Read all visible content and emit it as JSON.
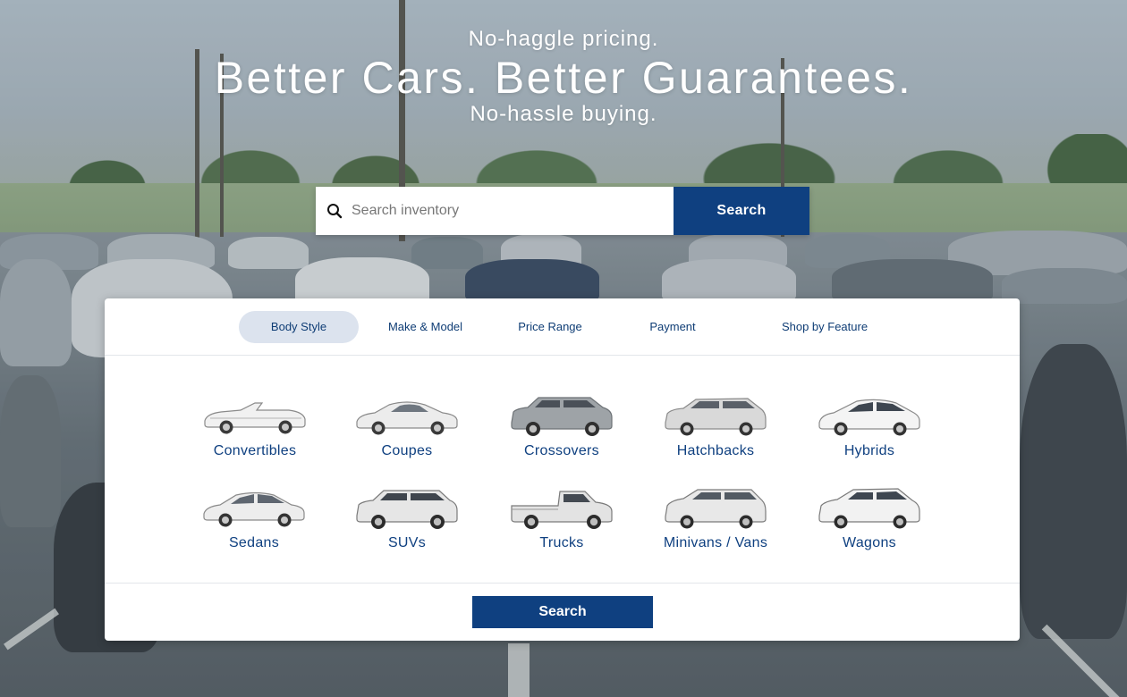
{
  "hero": {
    "line1": "No-haggle pricing.",
    "title": "Better Cars. Better Guarantees.",
    "line2": "No-hassle buying."
  },
  "search": {
    "placeholder": "Search inventory",
    "button_label": "Search"
  },
  "tabs": [
    {
      "label": "Body Style",
      "active": true
    },
    {
      "label": "Make & Model",
      "active": false
    },
    {
      "label": "Price Range",
      "active": false
    },
    {
      "label": "Payment",
      "active": false
    },
    {
      "label": "Shop by Feature",
      "active": false
    }
  ],
  "body_styles": [
    {
      "label": "Convertibles",
      "icon": "convertible-icon"
    },
    {
      "label": "Coupes",
      "icon": "coupe-icon"
    },
    {
      "label": "Crossovers",
      "icon": "crossover-icon"
    },
    {
      "label": "Hatchbacks",
      "icon": "hatchback-icon"
    },
    {
      "label": "Hybrids",
      "icon": "hybrid-icon"
    },
    {
      "label": "Sedans",
      "icon": "sedan-icon"
    },
    {
      "label": "SUVs",
      "icon": "suv-icon"
    },
    {
      "label": "Trucks",
      "icon": "truck-icon"
    },
    {
      "label": "Minivans / Vans",
      "icon": "minivan-icon"
    },
    {
      "label": "Wagons",
      "icon": "wagon-icon"
    }
  ],
  "panel": {
    "search_label": "Search"
  },
  "colors": {
    "brand_blue": "#0f4080",
    "tab_active_bg": "#dce3ee",
    "link_text": "#0f3d75"
  }
}
